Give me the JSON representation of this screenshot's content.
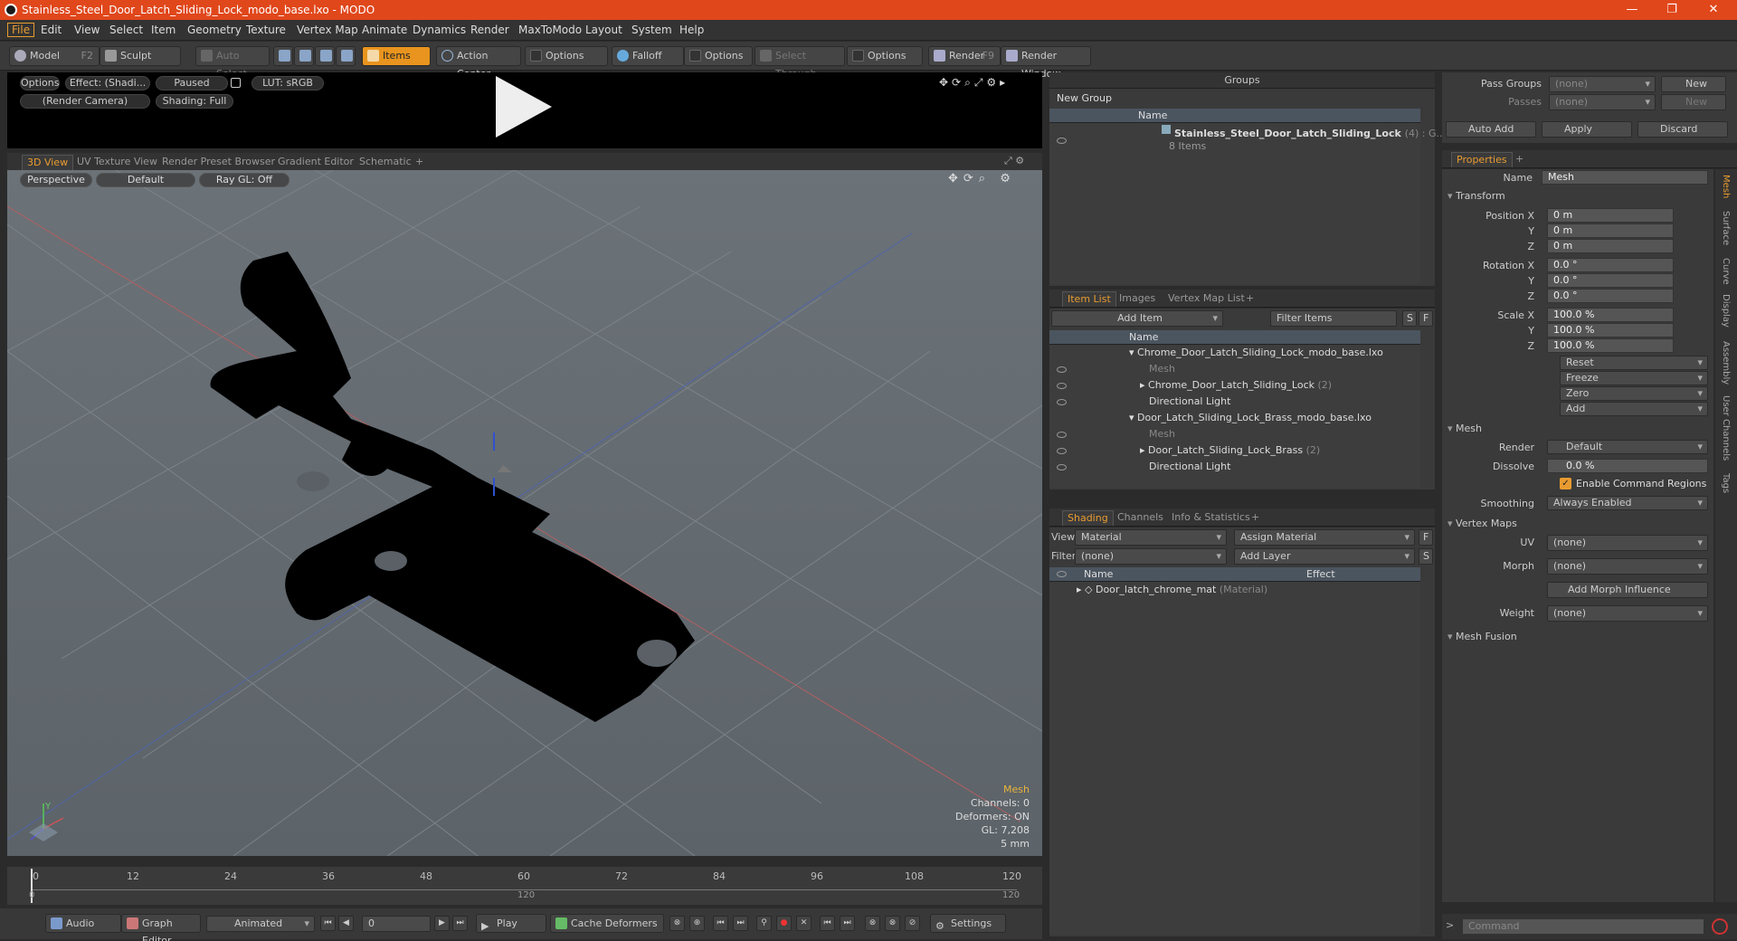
{
  "window": {
    "title": "Stainless_Steel_Door_Latch_Sliding_Lock_modo_base.lxo - MODO"
  },
  "menu": [
    "File",
    "Edit",
    "View",
    "Select",
    "Item",
    "Geometry",
    "Texture",
    "Vertex Map",
    "Animate",
    "Dynamics",
    "Render",
    "MaxToModo",
    "Layout",
    "System",
    "Help"
  ],
  "toolbar": {
    "model": "Model",
    "model_key": "F2",
    "sculpt": "Sculpt",
    "auto_select": "Auto Select",
    "items": "Items",
    "action_center": "Action Center",
    "options1": "Options",
    "falloff": "Falloff",
    "options2": "Options",
    "select_through": "Select Through",
    "options3": "Options",
    "render": "Render",
    "render_key": "F9",
    "render_window": "Render Window"
  },
  "preview": {
    "options": "Options",
    "effect": "Effect: (Shadi...",
    "paused": "Paused",
    "lut": "LUT: sRGB",
    "camera": "(Render Camera)",
    "shading": "Shading: Full"
  },
  "viewtabs": [
    "3D View",
    "UV Texture View",
    "Render Preset Browser",
    "Gradient Editor",
    "Schematic",
    "+"
  ],
  "viewport": {
    "perspective": "Perspective",
    "default": "Default",
    "raygl": "Ray GL: Off",
    "stats": {
      "title": "Mesh",
      "channels": "Channels: 0",
      "deformers": "Deformers: ON",
      "gl": "GL: 7,208",
      "unit": "5 mm"
    },
    "axis_y": "Y"
  },
  "timeline": {
    "top_ticks": [
      "0",
      "12",
      "24",
      "36",
      "48",
      "60",
      "72",
      "84",
      "96",
      "108",
      "120"
    ],
    "bottom_left": "0",
    "bottom_mid": "120",
    "bottom_right": "120"
  },
  "bottombar": {
    "audio": "Audio",
    "graph_editor": "Graph Editor",
    "animated": "Animated",
    "frame": "0",
    "play": "Play",
    "cache_deformers": "Cache Deformers",
    "settings": "Settings"
  },
  "groups": {
    "title": "Groups",
    "new_group": "New Group",
    "col_name": "Name",
    "item_name": "Stainless_Steel_Door_Latch_Sliding_Lock",
    "item_count": "(4) : G...",
    "item_sub": "8 Items"
  },
  "itemlist": {
    "tabs": [
      "Item List",
      "Images",
      "Vertex Map List",
      "+"
    ],
    "add_item": "Add Item",
    "filter": "Filter Items",
    "s": "S",
    "f": "F",
    "col_name": "Name",
    "rows": [
      {
        "label": "Chrome_Door_Latch_Sliding_Lock_modo_base.lxo",
        "extra": "",
        "dim": false
      },
      {
        "label": "Mesh",
        "extra": "",
        "dim": true
      },
      {
        "label": "Chrome_Door_Latch_Sliding_Lock",
        "extra": "(2)",
        "dim": false
      },
      {
        "label": "Directional Light",
        "extra": "",
        "dim": false
      },
      {
        "label": "Door_Latch_Sliding_Lock_Brass_modo_base.lxo",
        "extra": "",
        "dim": false
      },
      {
        "label": "Mesh",
        "extra": "",
        "dim": true
      },
      {
        "label": "Door_Latch_Sliding_Lock_Brass",
        "extra": "(2)",
        "dim": false
      },
      {
        "label": "Directional Light",
        "extra": "",
        "dim": false
      }
    ]
  },
  "shading": {
    "tabs": [
      "Shading",
      "Channels",
      "Info & Statistics",
      "+"
    ],
    "view_label": "View",
    "view_value": "Material",
    "assign": "Assign Material",
    "f": "F",
    "filter_label": "Filter",
    "filter_value": "(none)",
    "add_layer": "Add Layer",
    "s": "S",
    "col_name": "Name",
    "col_effect": "Effect",
    "row_name": "Door_latch_chrome_mat",
    "row_type": "(Material)"
  },
  "passes": {
    "pass_groups": "Pass Groups",
    "passes": "Passes",
    "none": "(none)",
    "new": "New",
    "auto_add": "Auto Add",
    "apply": "Apply",
    "discard": "Discard"
  },
  "properties": {
    "title": "Properties",
    "name_label": "Name",
    "name_value": "Mesh",
    "transform": "Transform",
    "pos_label": "Position X",
    "y": "Y",
    "z": "Z",
    "pos": [
      "0 m",
      "0 m",
      "0 m"
    ],
    "rot_label": "Rotation X",
    "rot": [
      "0.0 °",
      "0.0 °",
      "0.0 °"
    ],
    "scale_label": "Scale X",
    "scale": [
      "100.0 %",
      "100.0 %",
      "100.0 %"
    ],
    "reset": "Reset",
    "freeze": "Freeze",
    "zero": "Zero",
    "add": "Add",
    "mesh": "Mesh",
    "render_label": "Render",
    "render_value": "Default",
    "dissolve_label": "Dissolve",
    "dissolve_value": "0.0 %",
    "enable_cmd": "Enable Command Regions",
    "smoothing_label": "Smoothing",
    "smoothing_value": "Always Enabled",
    "vertex_maps": "Vertex Maps",
    "uv_label": "UV",
    "uv_value": "(none)",
    "morph_label": "Morph",
    "morph_value": "(none)",
    "add_morph": "Add Morph Influence",
    "weight_label": "Weight",
    "weight_value": "(none)",
    "mesh_fusion": "Mesh Fusion",
    "vtabs": [
      "Mesh",
      "Surface",
      "Curve",
      "Display",
      "Assembly",
      "User Channels",
      "Tags"
    ],
    "command": "Command"
  },
  "colors": {
    "titlebar": "#e0471b",
    "accent": "#e89b30"
  }
}
